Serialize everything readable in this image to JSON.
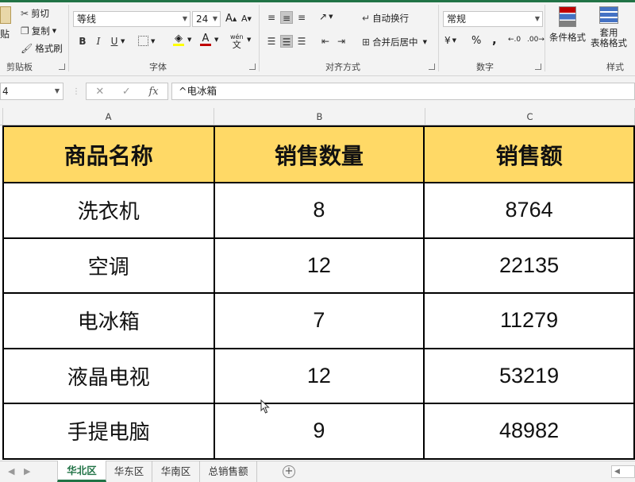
{
  "ribbon": {
    "clipboard": {
      "paste_label": "贴",
      "cut_label": "剪切",
      "copy_label": "复制",
      "format_painter_label": "格式刷",
      "group_label": "剪贴板"
    },
    "font": {
      "font_name": "等线",
      "font_size": "24",
      "bold": "B",
      "italic": "I",
      "underline": "U",
      "wen_label": "wén",
      "group_label": "字体"
    },
    "alignment": {
      "wrap_text_label": "自动换行",
      "merge_center_label": "合并后居中",
      "group_label": "对齐方式"
    },
    "number": {
      "format_value": "常规",
      "percent": "%",
      "comma": ",",
      "group_label": "数字"
    },
    "styles": {
      "conditional_formatting_label": "条件格式",
      "table_format_line1": "套用",
      "table_format_line2": "表格格式",
      "group_label": "样式"
    }
  },
  "formula_bar": {
    "name_box_value": "4",
    "fx_label": "fx",
    "formula_value": "^电冰箱"
  },
  "columns": [
    "A",
    "B",
    "C"
  ],
  "table": {
    "headers": [
      "商品名称",
      "销售数量",
      "销售额"
    ],
    "rows": [
      [
        "洗衣机",
        "8",
        "8764"
      ],
      [
        "空调",
        "12",
        "22135"
      ],
      [
        "电冰箱",
        "7",
        "11279"
      ],
      [
        "液晶电视",
        "12",
        "53219"
      ],
      [
        "手提电脑",
        "9",
        "48982"
      ]
    ]
  },
  "sheet_tabs": [
    {
      "label": "华北区",
      "active": true
    },
    {
      "label": "华东区",
      "active": false
    },
    {
      "label": "华南区",
      "active": false
    },
    {
      "label": "总销售额",
      "active": false
    }
  ],
  "colors": {
    "accent": "#217346",
    "header_fill": "#ffd966",
    "font_color_bar": "#c00000",
    "fill_color_bar": "#ffff00"
  }
}
